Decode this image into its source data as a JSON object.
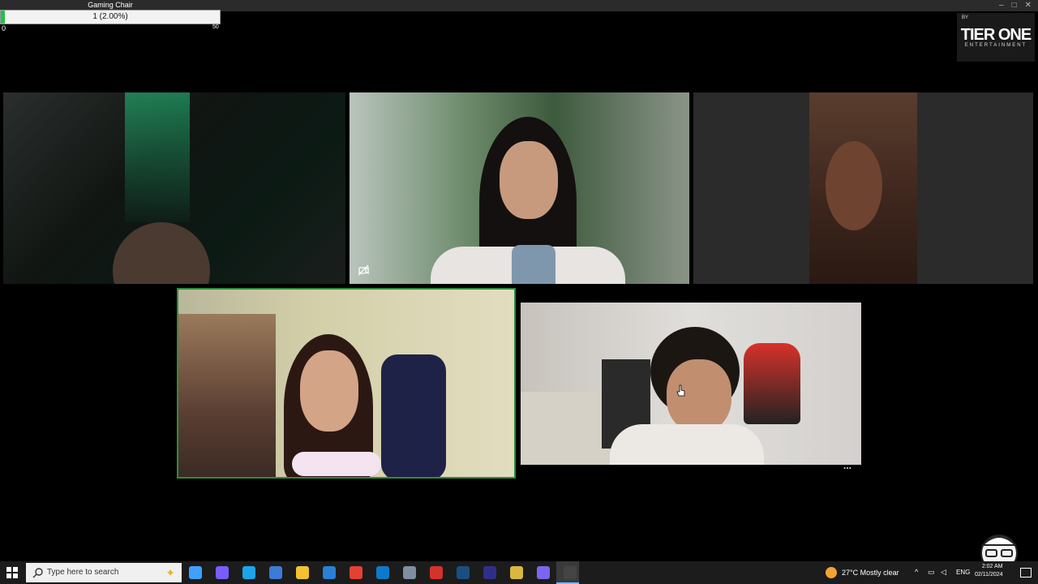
{
  "goal": {
    "title": "Gaming Chair",
    "progress_text": "1 (2.00%)",
    "progress_fraction": 0.02,
    "min": "0",
    "max": "50"
  },
  "brand": {
    "by": "BY",
    "name": "TIER ONE",
    "sub": "ENTERTAINMENT"
  },
  "tiles": [
    {
      "id": "participant-1"
    },
    {
      "id": "participant-2",
      "muted_video_icon": "camera-off-icon"
    },
    {
      "id": "participant-3"
    },
    {
      "id": "participant-4",
      "active_speaker": true
    },
    {
      "id": "participant-5",
      "menu": "..."
    }
  ],
  "taskbar": {
    "search_placeholder": "Type here to search",
    "weather": "27°C  Mostly clear",
    "language": "ENG",
    "time": "2:02 AM",
    "date": "02/11/2024",
    "icons": [
      "copilot-icon",
      "chat-app-icon",
      "edge-icon",
      "store-icon",
      "files-icon",
      "mail-icon",
      "chrome-icon",
      "notes-icon",
      "app-icon",
      "game-icon",
      "steam-icon",
      "audio-app-icon",
      "script-icon",
      "discord-icon",
      "obs-icon"
    ]
  },
  "colors": {
    "goal_fill": "#23c14c",
    "active_speaker_border": "#2d8d3d",
    "taskbar_bg": "#1c1c1c"
  }
}
